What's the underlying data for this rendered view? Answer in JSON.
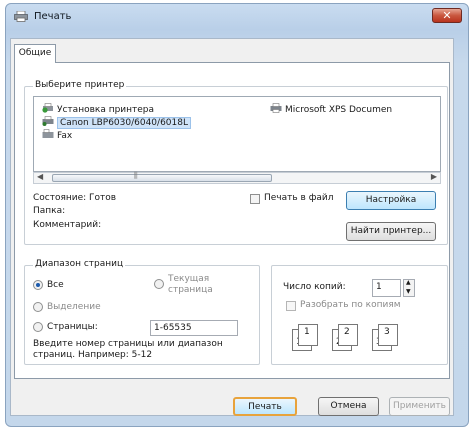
{
  "window": {
    "title": "Печать"
  },
  "tabs": [
    {
      "label": "Общие"
    }
  ],
  "printer_group": {
    "legend": "Выберите принтер",
    "printers": [
      {
        "label": "Установка принтера",
        "icon": "add-printer-icon"
      },
      {
        "label": "Microsoft XPS Documen",
        "icon": "printer-icon"
      },
      {
        "label": "Canon LBP6030/6040/6018L",
        "icon": "printer-icon",
        "selected": true
      },
      {
        "label": "Fax",
        "icon": "fax-icon"
      }
    ]
  },
  "status": {
    "label": "Состояние:",
    "value": "Готов"
  },
  "folder": {
    "label": "Папка:"
  },
  "comment": {
    "label": "Комментарий:"
  },
  "print_to_file": {
    "label": "Печать в файл",
    "checked": false
  },
  "buttons": {
    "settings": "Настройка",
    "find_printer": "Найти принтер...",
    "print": "Печать",
    "cancel": "Отмена",
    "apply": "Применить"
  },
  "range_group": {
    "legend": "Диапазон страниц",
    "all": "Все",
    "current": "Текущая страница",
    "selection": "Выделение",
    "pages": "Страницы:",
    "pages_value": "1-65535",
    "hint": "Введите номер страницы или диапазон страниц. Например: 5-12"
  },
  "copies": {
    "label": "Число копий:",
    "value": "1",
    "collate": "Разобрать по копиям"
  },
  "collate_graphic": [
    "1",
    "1",
    "2",
    "2",
    "3",
    "3"
  ],
  "colors": {
    "accent": "#3c7fb1",
    "close": "#c9573f"
  }
}
